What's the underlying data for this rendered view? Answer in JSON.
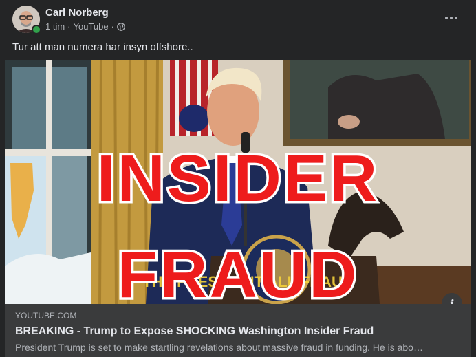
{
  "post": {
    "author": "Carl Norberg",
    "time": "1 tim",
    "source": "YouTube",
    "separator": "·",
    "text": "Tur att man numera har insyn offshore.."
  },
  "video": {
    "overlay_line1": "INSIDER",
    "overlay_line2": "FRAUD",
    "seal_text": "PRESIDENT OF THE UNITED STATES",
    "banner_text": "THE PRESIDENT ALL FRAUD"
  },
  "link_preview": {
    "domain": "YOUTUBE.COM",
    "title": "BREAKING - Trump to Expose SHOCKING Washington Insider Fraud",
    "description": "President Trump is set to make startling revelations about massive fraud in funding. He is abo…"
  },
  "icons": {
    "globe": "globe-icon",
    "more": "more-options-icon",
    "info": "info-icon"
  },
  "colors": {
    "card_bg": "#242526",
    "preview_bg": "#3a3b3c",
    "online": "#31a24c",
    "overlay_red": "#ee1c1c"
  }
}
